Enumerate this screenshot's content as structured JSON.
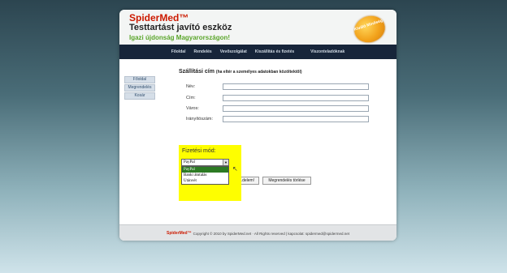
{
  "header": {
    "brand": "SpiderMed™",
    "tagline": "Testtartást javító eszköz",
    "slogan": "Igazi újdonság Magyarországon!",
    "badge": "Kiváló Minőség"
  },
  "nav": [
    "Főoldal",
    "Rendelés",
    "Vevőszolgálat",
    "Kiszállítás és fizetés",
    "",
    "Viszonteladóknak"
  ],
  "sidebar": [
    "Főoldal",
    "Megrendelés",
    "Kosár"
  ],
  "shipping": {
    "title": "Szállítási cím",
    "note": "(ha eltér a személyes adatokban közöltektől)",
    "fields": [
      {
        "label": "Név:",
        "value": ""
      },
      {
        "label": "Cím:",
        "value": ""
      },
      {
        "label": "Város:",
        "value": ""
      },
      {
        "label": "Irányítószám:",
        "value": ""
      }
    ]
  },
  "payment": {
    "title": "Fizetési mód:",
    "selected": "PayPal",
    "options": [
      "PayPal",
      "Banki átutalás",
      "Utánvét"
    ]
  },
  "buttons": {
    "submit": "...delem!",
    "clear": "Megrendelés törlése"
  },
  "footer": {
    "brand": "SpiderMed™",
    "text": "Copyright © 2010 by SpiderMed.net · All Rights reserved | kapcsolat: spidermed@spidermed.net"
  },
  "colors": {
    "brand": "#cc1a00",
    "slogan": "#5aa52a",
    "nav_bg": "#17253a",
    "highlight": "#fefe00"
  }
}
